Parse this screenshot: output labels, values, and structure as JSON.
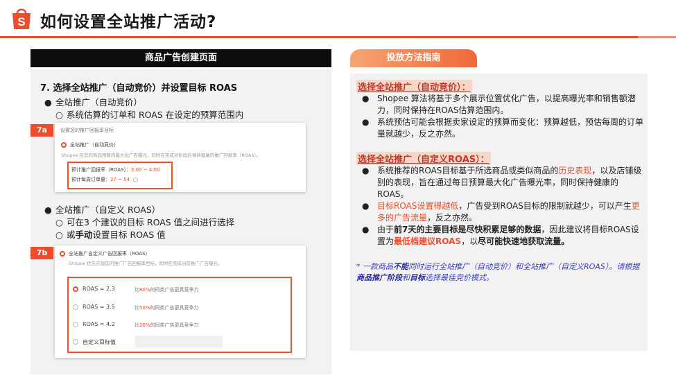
{
  "header": {
    "title": "如何设置全站推广活动?"
  },
  "left": {
    "header": "商品广告创建页面",
    "step_title": "7. 选择全站推广（自动竞价）并设置目标 ROAS",
    "auto_bullet": "全站推广（自动竞价）",
    "auto_sub": "系统估算的订单和 ROAS 在设定的预算范围内",
    "custom_bullet": "全站推广（自定义 ROAS）",
    "custom_sub1": "可在3 个建议的目标 ROAS 值之间进行选择",
    "custom_sub2_prefix": "或",
    "custom_sub2_bold": "手动",
    "custom_sub2_suffix": "设置目标 ROAS 值",
    "tag_a": "7a",
    "tag_b": "7b",
    "shot_a": {
      "heading": "设置您的推广回报率目标",
      "option": "全站推广（自动竞价）",
      "desc": "Shopee 在您的商品预算内最大化广告曝光，同时在完成对阶段后保持健康的推广回报率（ROAS）。",
      "roas_label": "预计推广回报率（ROAS）：",
      "roas_value": "2.00 ~ 4.00",
      "orders_label": "预计每周订单量：",
      "orders_value": "27 ~ 54"
    },
    "shot_b": {
      "heading": "全站推广自定义广告回报率（ROAS）",
      "desc": "Shopee 优先实现您的推广广告回报率目标，同时在完成当前推广广告曝光。",
      "options": [
        {
          "label": "ROAS = 2.3",
          "pre": "比",
          "pct": "80%",
          "post": "的同类广告更具竞争力"
        },
        {
          "label": "ROAS = 3.5",
          "pre": "比",
          "pct": "50%",
          "post": "的同类广告更具竞争力"
        },
        {
          "label": "ROAS = 4.2",
          "pre": "比",
          "pct": "20%",
          "post": "的同类广告更具竞争力"
        }
      ],
      "custom_label": "自定义目标值"
    }
  },
  "right": {
    "header": "投放方法指南",
    "sec1_title": "选择全站推广（自动竞价）：",
    "sec1_b1": "Shopee 算法将基于多个展示位置优化广告，以提高曝光率和销售额潜力，同时保持在ROAS估算范围内。",
    "sec1_b2": "系统预估可能会根据卖家设定的预算而变化：预算越低，预估每周的订单量就越少，反之亦然。",
    "sec2_title": "选择全站推广（自定义ROAS）：",
    "sec2_b1_a": "系统推荐的ROAS目标基于所选商品或类似商品的",
    "sec2_b1_red": "历史表现",
    "sec2_b1_b": "，以及店铺级别的表现，旨在通过每日预算最大化广告曝光率，同时保持健康的ROAS。",
    "sec2_b2_red1": "目标ROAS设置得越低",
    "sec2_b2_a": "，广告受到ROAS目标的限制就越少，可以产生",
    "sec2_b2_red2": "更多的广告流量",
    "sec2_b2_b": "，反之亦然。",
    "sec2_b3_a": "由于",
    "sec2_b3_bold1": "前7天的主要目标是尽快积累足够的数据",
    "sec2_b3_b": "，因此建议将目标ROAS设置为",
    "sec2_b3_red": "最低档建议ROAS",
    "sec2_b3_c": "，以",
    "sec2_b3_bold2": "尽可能快速地获取流量。",
    "footnote_a": "* 一款商品",
    "footnote_b1": "不能",
    "footnote_c": "同时运行全站推广（自动竞价）和全站推广（自定义ROAS）。请根据",
    "footnote_b2": "商品推广阶段",
    "footnote_d": "和",
    "footnote_b3": "目标",
    "footnote_e": "选择最佳竞价模式。"
  },
  "bullets": {
    "filled": "●",
    "hollow": "○"
  },
  "colors": {
    "accent": "#ee4d2d",
    "footnote": "#3b3bc9"
  }
}
